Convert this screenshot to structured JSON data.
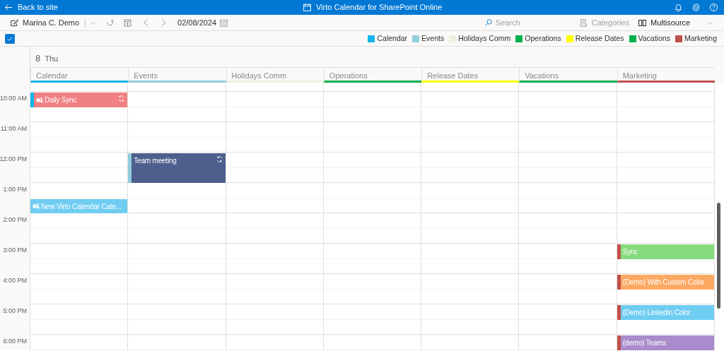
{
  "top_bar": {
    "back_link": "Back to site",
    "title": "Virto Calendar for SharePoint Online"
  },
  "toolbar": {
    "user": "Marina C. Demo",
    "date": "02/08/2024",
    "search": {
      "placeholder": "Search"
    },
    "categories": "Categories",
    "view": "Multisource"
  },
  "select_all": {
    "checked": true
  },
  "legend": [
    {
      "label": "Calendar",
      "color": "#13b5ea"
    },
    {
      "label": "Events",
      "color": "#92cddc"
    },
    {
      "label": "Holidays Comm",
      "color": "#ebf1de"
    },
    {
      "label": "Operations",
      "color": "#00b050"
    },
    {
      "label": "Release Dates",
      "color": "#ffff00"
    },
    {
      "label": "Vacations",
      "color": "#00b050"
    },
    {
      "label": "Marketing",
      "color": "#c0504d"
    }
  ],
  "day": {
    "number": "8",
    "weekday": "Thu"
  },
  "columns": [
    {
      "label": "Calendar",
      "color": "#13b5ea",
      "kind": "calendar"
    },
    {
      "label": "Events",
      "color": "#92cddc",
      "kind": "events"
    },
    {
      "label": "Holidays Comm",
      "color": "#ebf1de",
      "kind": "holidays"
    },
    {
      "label": "Operations",
      "color": "#00b050",
      "kind": "operations"
    },
    {
      "label": "Release Dates",
      "color": "#ffff00",
      "kind": "releases"
    },
    {
      "label": "Vacations",
      "color": "#00b050",
      "kind": "vacations"
    },
    {
      "label": "Marketing",
      "color": "#c0504d",
      "kind": "marketing"
    }
  ],
  "times": [
    {
      "label": "10:00 AM",
      "events": [
        {
          "title": "Daily Sync",
          "kind": "calendar",
          "late": false,
          "long": false,
          "color": "#f08083",
          "stripe": true,
          "teams": true,
          "recurring": true
        }
      ]
    },
    {
      "label": "11:00 AM"
    },
    {
      "label": "12:00 PM",
      "events": [
        {
          "title": "Team meeting",
          "kind": "events",
          "late": false,
          "long": true,
          "color": "#4e5f8e",
          "stripe": true,
          "teams": false,
          "recurring": true
        }
      ]
    },
    {
      "label": "1:00 PM",
      "events": [
        {
          "title": "New Virto Calendar Cate...",
          "kind": "calendar",
          "late": true,
          "long": false,
          "color": "#6fcdf2",
          "stripe": false,
          "teams": true,
          "recurring": false
        }
      ]
    },
    {
      "label": "2:00 PM"
    },
    {
      "label": "3:00 PM",
      "events": [
        {
          "title": "Sync",
          "kind": "marketing",
          "late": false,
          "long": false,
          "color": "#86dc7d",
          "stripe": true,
          "teams": false,
          "recurring": false
        }
      ]
    },
    {
      "label": "4:00 PM",
      "events": [
        {
          "title": "(Demo) With Custom Color",
          "kind": "marketing",
          "late": false,
          "long": false,
          "color": "#fca963",
          "stripe": true,
          "teams": false,
          "recurring": false
        }
      ]
    },
    {
      "label": "5:00 PM",
      "events": [
        {
          "title": "(Demo) Linkedin Color",
          "kind": "marketing",
          "late": false,
          "long": false,
          "color": "#6fcdf2",
          "stripe": true,
          "teams": false,
          "recurring": false
        }
      ]
    },
    {
      "label": "6:00 PM",
      "events": [
        {
          "title": "(demo) Teams",
          "kind": "marketing",
          "late": false,
          "long": false,
          "color": "#a98ccb",
          "stripe": true,
          "teams": false,
          "recurring": false
        }
      ]
    }
  ]
}
